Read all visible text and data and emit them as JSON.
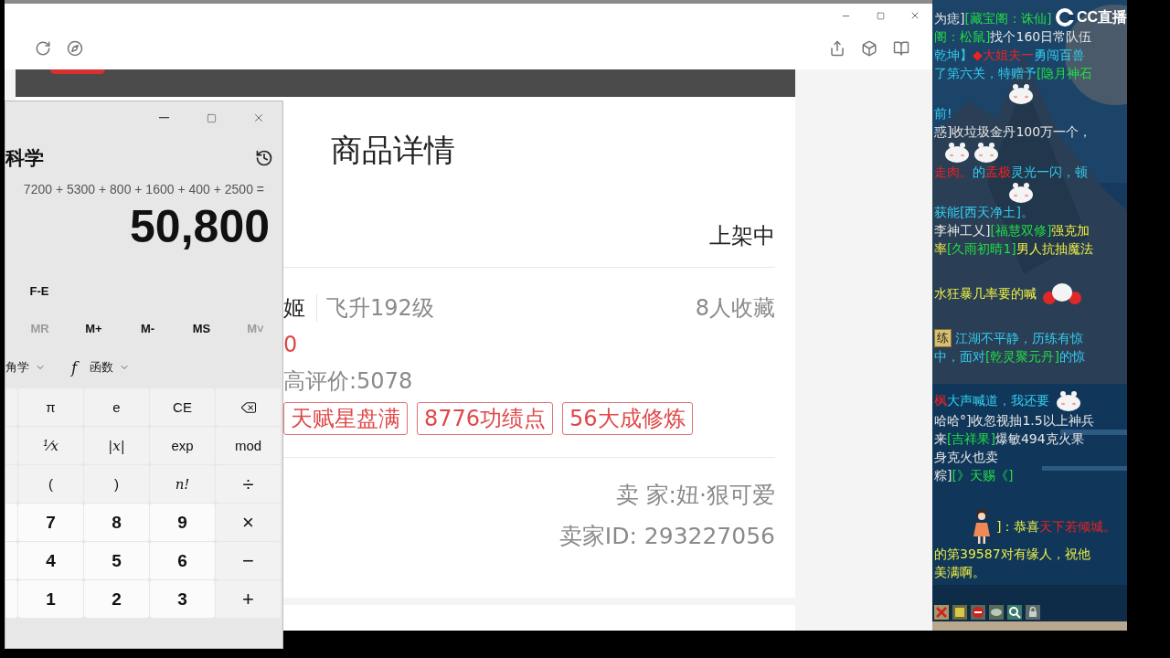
{
  "calculator": {
    "mode": "科学",
    "expression": "7200 + 5300 + 800 + 1600 + 400 + 2500 =",
    "result": "50,800",
    "fe": "F-E",
    "memory": [
      {
        "label": "MR",
        "disabled": true
      },
      {
        "label": "M+",
        "disabled": false
      },
      {
        "label": "M-",
        "disabled": false
      },
      {
        "label": "MS",
        "disabled": false
      },
      {
        "label": "M˅",
        "disabled": true
      }
    ],
    "dropdowns": [
      {
        "label": "角学"
      },
      {
        "icon_text": "f",
        "label": "函数"
      }
    ],
    "keys": [
      {
        "label": "π",
        "kind": "function"
      },
      {
        "label": "e",
        "kind": "function"
      },
      {
        "label": "CE",
        "kind": "function"
      },
      {
        "kind": "backspace"
      },
      {
        "label": "¹⁄x",
        "kind": "math"
      },
      {
        "label": "|x|",
        "kind": "math"
      },
      {
        "label": "exp",
        "kind": "function"
      },
      {
        "label": "mod",
        "kind": "function"
      },
      {
        "label": "(",
        "kind": "function"
      },
      {
        "label": ")",
        "kind": "function"
      },
      {
        "label": "n!",
        "kind": "math"
      },
      {
        "label": "÷",
        "kind": "operator"
      },
      {
        "label": "7",
        "kind": "number"
      },
      {
        "label": "8",
        "kind": "number"
      },
      {
        "label": "9",
        "kind": "number"
      },
      {
        "label": "×",
        "kind": "operator"
      },
      {
        "label": "4",
        "kind": "number"
      },
      {
        "label": "5",
        "kind": "number"
      },
      {
        "label": "6",
        "kind": "number"
      },
      {
        "label": "−",
        "kind": "operator"
      },
      {
        "label": "1",
        "kind": "number"
      },
      {
        "label": "2",
        "kind": "number"
      },
      {
        "label": "3",
        "kind": "number"
      },
      {
        "label": "+",
        "kind": "operator"
      }
    ]
  },
  "product": {
    "title": "商品详情",
    "status": "上架中",
    "name": "姬",
    "level": "飞升192级",
    "favorites": "8人收藏",
    "price": "0",
    "rating": "高评价:5078",
    "tags": [
      "天赋星盘满",
      "8776功绩点",
      "56大成修炼"
    ],
    "seller": "卖 家:妞·狠可爱",
    "seller_id": "卖家ID: 293227056"
  },
  "stream_logo": {
    "text": "CC直播"
  },
  "chat": [
    [
      {
        "segments": [
          {
            "text": "为痣]",
            "color": "#e6e6e6"
          },
          {
            "text": "[藏宝阁：诛仙]",
            "color": "#22dd44"
          }
        ]
      },
      {
        "segments": [
          {
            "text": "阁：松鼠]",
            "color": "#22dd44"
          },
          {
            "text": "找个160日常队伍",
            "color": "#e6e6e6"
          }
        ]
      },
      {
        "segments": [
          {
            "text": "乾坤】",
            "color": "#33ccee"
          },
          {
            "text": "◆大姐夫一",
            "color": "#ee2222"
          },
          {
            "text": "勇闯百兽",
            "color": "#33ccee"
          }
        ]
      },
      {
        "segments": [
          {
            "text": "了第六关，特赠予",
            "color": "#33ccee"
          },
          {
            "text": "[隐月神石",
            "color": "#22dd44"
          }
        ]
      },
      {
        "icons": [
          {
            "kind": "bunny"
          }
        ]
      },
      {
        "segments": [
          {
            "text": "前!",
            "color": "#33ccee"
          }
        ]
      },
      {
        "segments": [
          {
            "text": "惑]收垃圾金丹100万一个，",
            "color": "#e6e6e6"
          }
        ]
      },
      {
        "icons": [
          {
            "kind": "bunny"
          },
          {
            "kind": "bunny"
          }
        ]
      },
      {
        "segments": [
          {
            "text": "走肉。",
            "color": "#ee2222"
          },
          {
            "text": "的",
            "color": "#33ccee"
          },
          {
            "text": "孟极",
            "color": "#ee2222"
          },
          {
            "text": "灵光一闪，顿",
            "color": "#33ccee"
          }
        ]
      },
      {
        "icons": [
          {
            "kind": "bunny"
          }
        ]
      },
      {
        "segments": [
          {
            "text": "获能[西天净土]。",
            "color": "#33ccee"
          }
        ]
      },
      {
        "segments": [
          {
            "text": "李神工乂]",
            "color": "#e6e6e6"
          },
          {
            "text": "[福慧双修]",
            "color": "#22dd44"
          },
          {
            "text": "强克加",
            "color": "#eeee44"
          }
        ]
      },
      {
        "segments": [
          {
            "text": "率",
            "color": "#eeee44"
          },
          {
            "text": "[久雨初晴1]",
            "color": "#22dd44"
          },
          {
            "text": "男人抗抽魔法",
            "color": "#eeee44"
          }
        ]
      }
    ],
    [
      {
        "segments": [
          {
            "text": "水狂暴几率要的喊",
            "color": "#eeee44"
          }
        ],
        "icons": [
          {
            "kind": "pompom"
          }
        ]
      }
    ],
    [
      {
        "badge": "练",
        "segments": [
          {
            "text": "江湖不平静，历练有惊",
            "color": "#33ccee"
          }
        ]
      },
      {
        "segments": [
          {
            "text": "中，面对",
            "color": "#33ccee"
          },
          {
            "text": "[乾灵聚元丹]",
            "color": "#22dd44"
          },
          {
            "text": "的惊",
            "color": "#33ccee"
          }
        ]
      }
    ],
    [
      {
        "segments": [
          {
            "text": "枫",
            "color": "#ee2222"
          },
          {
            "text": "大声喊道，我还要",
            "color": "#33ccee"
          }
        ],
        "icons": [
          {
            "kind": "bunny"
          }
        ]
      },
      {
        "segments": [
          {
            "text": "哈哈°]收忽视抽1.5以上神兵",
            "color": "#e6e6e6"
          }
        ]
      },
      {
        "segments": [
          {
            "text": "来",
            "color": "#e6e6e6"
          },
          {
            "text": "[吉祥果]",
            "color": "#22dd44"
          },
          {
            "text": "爆敏494克火果",
            "color": "#e6e6e6"
          }
        ]
      },
      {
        "segments": [
          {
            "text": "身克火也卖",
            "color": "#e6e6e6"
          }
        ]
      },
      {
        "segments": [
          {
            "text": "粽]",
            "color": "#e6e6e6"
          },
          {
            "text": "[》天赐《]",
            "color": "#22dd44"
          }
        ]
      }
    ],
    [
      {
        "icons": [
          {
            "kind": "doll"
          }
        ],
        "segments": [
          {
            "text": "]：恭喜",
            "color": "#eeee44"
          },
          {
            "text": "天下若倾城。",
            "color": "#ee2222"
          }
        ]
      },
      {
        "segments": [
          {
            "text": "的第39587对有缘人，祝他",
            "color": "#eeee44"
          }
        ]
      },
      {
        "segments": [
          {
            "text": "美满啊。",
            "color": "#eeee44"
          }
        ]
      }
    ]
  ]
}
